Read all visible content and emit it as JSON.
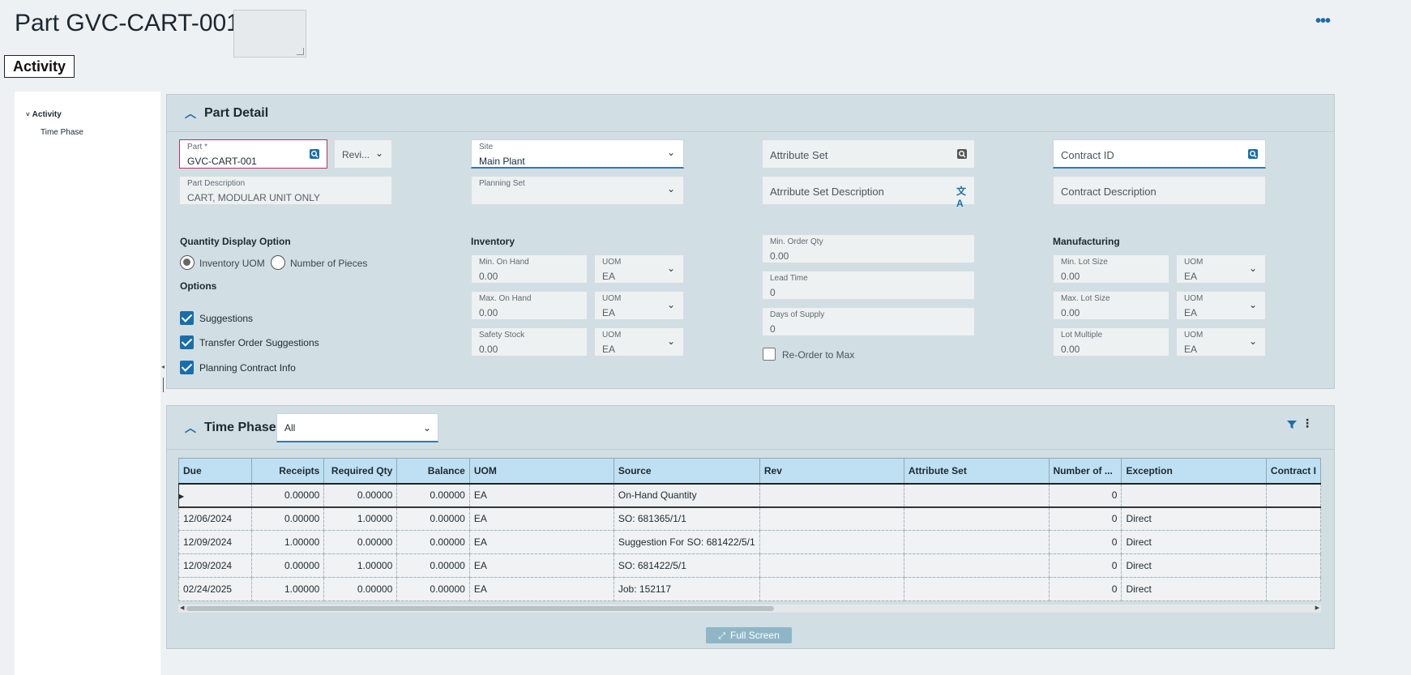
{
  "header": {
    "title": "Part GVC-CART-001",
    "tab": "Activity"
  },
  "tree": {
    "root": "Activity",
    "child": "Time Phase"
  },
  "part_detail": {
    "title": "Part Detail",
    "part": {
      "label": "Part *",
      "value": "GVC-CART-001"
    },
    "revision": {
      "value": "Revi..."
    },
    "part_description": {
      "label": "Part Description",
      "value": "CART, MODULAR UNIT ONLY"
    },
    "site": {
      "label": "Site",
      "value": "Main Plant"
    },
    "planning_set": {
      "label": "Planning Set",
      "value": ""
    },
    "attribute_set": {
      "placeholder": "Attribute Set"
    },
    "attribute_set_description": {
      "placeholder": "Atrribute Set Description"
    },
    "contract_id": {
      "placeholder": "Contract ID"
    },
    "contract_description": {
      "placeholder": "Contract Description"
    },
    "quantity_display": {
      "label": "Quantity Display Option",
      "options": [
        "Inventory UOM",
        "Number of Pieces"
      ],
      "selected": "Inventory UOM"
    },
    "options": {
      "label": "Options",
      "items": [
        {
          "label": "Suggestions",
          "checked": true
        },
        {
          "label": "Transfer Order Suggestions",
          "checked": true
        },
        {
          "label": "Planning Contract Info",
          "checked": true
        }
      ]
    },
    "inventory": {
      "label": "Inventory",
      "min_on_hand": {
        "label": "Min. On Hand",
        "value": "0.00",
        "uom_label": "UOM",
        "uom": "EA"
      },
      "max_on_hand": {
        "label": "Max. On Hand",
        "value": "0.00",
        "uom_label": "UOM",
        "uom": "EA"
      },
      "safety_stock": {
        "label": "Safety Stock",
        "value": "0.00",
        "uom_label": "UOM",
        "uom": "EA"
      }
    },
    "ordering": {
      "min_order_qty": {
        "label": "Min. Order Qty",
        "value": "0.00"
      },
      "lead_time": {
        "label": "Lead Time",
        "value": "0"
      },
      "days_of_supply": {
        "label": "Days of Supply",
        "value": "0"
      },
      "reorder_to_max": {
        "label": "Re-Order to Max",
        "checked": false
      }
    },
    "manufacturing": {
      "label": "Manufacturing",
      "min_lot_size": {
        "label": "Min. Lot Size",
        "value": "0.00",
        "uom_label": "UOM",
        "uom": "EA"
      },
      "max_lot_size": {
        "label": "Max. Lot Size",
        "value": "0.00",
        "uom_label": "UOM",
        "uom": "EA"
      },
      "lot_multiple": {
        "label": "Lot Multiple",
        "value": "0.00",
        "uom_label": "UOM",
        "uom": "EA"
      }
    }
  },
  "time_phase": {
    "title": "Time Phase",
    "filter": "All",
    "columns": [
      "Due",
      "Receipts",
      "Required Qty",
      "Balance",
      "UOM",
      "Source",
      "Rev",
      "Attribute Set",
      "Number of ...",
      "Exception",
      "Contract I"
    ],
    "rows": [
      [
        "",
        "0.00000",
        "0.00000",
        "0.00000",
        "EA",
        "On-Hand Quantity",
        "",
        "",
        "0",
        "",
        ""
      ],
      [
        "12/06/2024",
        "0.00000",
        "1.00000",
        "0.00000",
        "EA",
        "SO: 681365/1/1",
        "",
        "",
        "0",
        "Direct",
        ""
      ],
      [
        "12/09/2024",
        "1.00000",
        "0.00000",
        "0.00000",
        "EA",
        "Suggestion For SO: 681422/5/1",
        "",
        "",
        "0",
        "Direct",
        ""
      ],
      [
        "12/09/2024",
        "0.00000",
        "1.00000",
        "0.00000",
        "EA",
        "SO: 681422/5/1",
        "",
        "",
        "0",
        "Direct",
        ""
      ],
      [
        "02/24/2025",
        "1.00000",
        "0.00000",
        "0.00000",
        "EA",
        "Job: 152117",
        "",
        "",
        "0",
        "Direct",
        ""
      ]
    ],
    "full_screen_label": "Full Screen"
  },
  "colors": {
    "accent": "#1a6ea8",
    "panel": "#d1dee3",
    "grid_header": "#bfe0f2"
  }
}
